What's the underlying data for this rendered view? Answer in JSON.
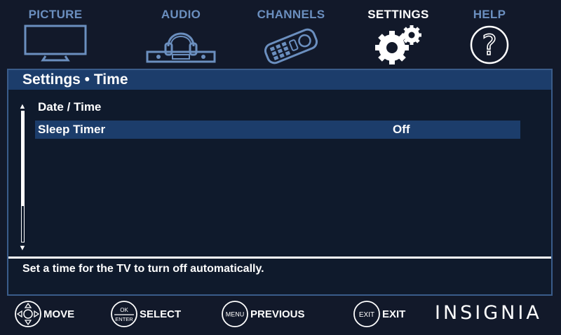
{
  "tabs": [
    {
      "label": "PICTURE",
      "icon": "tv-icon",
      "active": false
    },
    {
      "label": "AUDIO",
      "icon": "headphones-soundbar-icon",
      "active": false
    },
    {
      "label": "CHANNELS",
      "icon": "remote-control-icon",
      "active": false
    },
    {
      "label": "SETTINGS",
      "icon": "gears-icon",
      "active": true
    },
    {
      "label": "HELP",
      "icon": "question-mark-icon",
      "active": false
    }
  ],
  "panel": {
    "title": "Settings • Time",
    "items": [
      {
        "label": "Date / Time",
        "value": "",
        "selected": false
      },
      {
        "label": "Sleep Timer",
        "value": "Off",
        "selected": true
      }
    ],
    "help_text": "Set a time for the TV to turn off automatically."
  },
  "hints": {
    "move": {
      "label": "MOVE",
      "icon": "dpad-icon"
    },
    "select": {
      "label": "SELECT",
      "button_top": "OK",
      "button_bottom": "ENTER"
    },
    "previous": {
      "label": "PREVIOUS",
      "button": "MENU"
    },
    "exit": {
      "label": "EXIT",
      "button": "EXIT"
    }
  },
  "brand": "INSIGNIA",
  "colors": {
    "background": "#12192a",
    "accent_blue": "#1c3d6b",
    "inactive_tab": "#6b8fbf",
    "text": "#ffffff"
  }
}
